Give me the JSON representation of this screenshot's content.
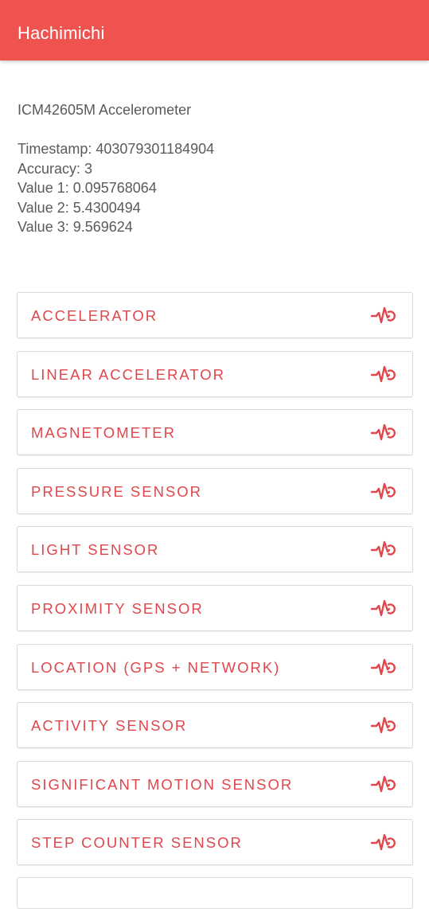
{
  "app": {
    "title": "Hachimichi",
    "accent_color": "#ef5350",
    "button_text_color": "#e0474c"
  },
  "sensor": {
    "name": "ICM42605M Accelerometer",
    "readings": [
      "Timestamp: 403079301184904",
      "Accuracy: 3",
      "Value 1: 0.095768064",
      "Value 2: 5.4300494",
      "Value 3: 9.569624"
    ]
  },
  "buttons": [
    {
      "label": "ACCELERATOR",
      "icon": "sensor-pulse-icon"
    },
    {
      "label": "LINEAR ACCELERATOR",
      "icon": "sensor-pulse-icon"
    },
    {
      "label": "MAGNETOMETER",
      "icon": "sensor-pulse-icon"
    },
    {
      "label": "PRESSURE SENSOR",
      "icon": "sensor-pulse-icon"
    },
    {
      "label": "LIGHT SENSOR",
      "icon": "sensor-pulse-icon"
    },
    {
      "label": "PROXIMITY SENSOR",
      "icon": "sensor-pulse-icon"
    },
    {
      "label": "LOCATION (GPS + NETWORK)",
      "icon": "sensor-pulse-icon"
    },
    {
      "label": "ACTIVITY SENSOR",
      "icon": "sensor-pulse-icon"
    },
    {
      "label": "SIGNIFICANT MOTION SENSOR",
      "icon": "sensor-pulse-icon"
    },
    {
      "label": "STEP COUNTER SENSOR",
      "icon": "sensor-pulse-icon"
    }
  ]
}
